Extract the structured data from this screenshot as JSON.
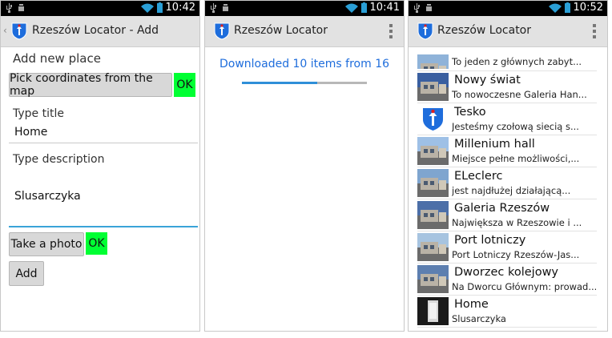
{
  "colors": {
    "accent": "#1e6ddc",
    "ok_green": "#00ff33",
    "actionbar": "#e2e2e2"
  },
  "screen_add": {
    "status": {
      "time": "10:42"
    },
    "actionbar": {
      "title": "Rzeszów Locator - Add"
    },
    "heading": "Add new place",
    "pick_button": "Pick coordinates from the map",
    "pick_ok": "OK",
    "title_label": "Type title",
    "title_value": "Home",
    "desc_label": "Type description",
    "desc_value": "Slusarczyka",
    "photo_button": "Take a photo",
    "photo_ok": "OK",
    "add_button": "Add"
  },
  "screen_download": {
    "status": {
      "time": "10:41"
    },
    "actionbar": {
      "title": "Rzeszów Locator"
    },
    "message": "Downloaded 10 items from 16",
    "progress": 0.6
  },
  "screen_list": {
    "status": {
      "time": "10:52"
    },
    "actionbar": {
      "title": "Rzeszów Locator"
    },
    "items": [
      {
        "title": "",
        "desc": "To jeden z głównych zabyt...",
        "thumb": "photo"
      },
      {
        "title": "Nowy świat",
        "desc": "To nowoczesne Galeria Han...",
        "thumb": "photo"
      },
      {
        "title": "Tesko",
        "desc": "Jesteśmy czołową siecią s...",
        "thumb": "logo"
      },
      {
        "title": "Millenium hall",
        "desc": "Miejsce pełne możliwości,...",
        "thumb": "photo"
      },
      {
        "title": "ELeclerc",
        "desc": "jest najdłużej działającą...",
        "thumb": "photo"
      },
      {
        "title": "Galeria Rzeszów",
        "desc": "Największa w Rzeszowie i ...",
        "thumb": "photo"
      },
      {
        "title": "Port lotniczy",
        "desc": "Port Lotniczy Rzeszów-Jas...",
        "thumb": "photo"
      },
      {
        "title": "Dworzec kolejowy",
        "desc": "Na Dworcu Głównym: prowad...",
        "thumb": "photo"
      },
      {
        "title": "Home",
        "desc": "Slusarczyka",
        "thumb": "photo-dark"
      }
    ]
  }
}
